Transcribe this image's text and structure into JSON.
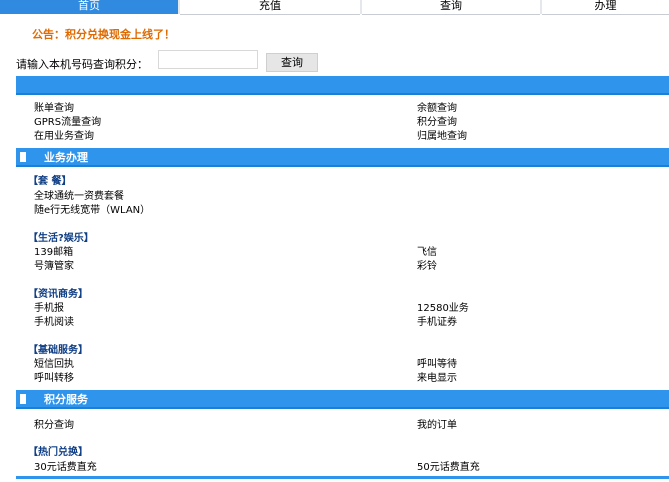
{
  "nav": {
    "tabs": [
      {
        "label": "首页",
        "active": true
      },
      {
        "label": "充值"
      },
      {
        "label": "查询"
      },
      {
        "label": "办理"
      }
    ]
  },
  "notice": "公告：积分兑换现金上线了！",
  "query": {
    "label": "请输入本机号码查询积分：",
    "value": "",
    "button": "查询"
  },
  "sections": {
    "query_items": {
      "left": [
        "账单查询",
        "GPRS流量查询",
        "在用业务查询"
      ],
      "right": [
        "余额查询",
        "积分查询",
        "归属地查询"
      ]
    },
    "business": {
      "title": "业务办理",
      "groups": [
        {
          "title": "【套  餐】",
          "left": [
            "全球通统一资费套餐",
            "随e行无线宽带（WLAN）"
          ],
          "right": []
        },
        {
          "title": "【生活?娱乐】",
          "left": [
            "139邮箱",
            "号簿管家"
          ],
          "right": [
            "飞信",
            "彩铃"
          ]
        },
        {
          "title": "【资讯商务】",
          "left": [
            "手机报",
            "手机阅读"
          ],
          "right": [
            "12580业务",
            "手机证券"
          ]
        },
        {
          "title": "【基础服务】",
          "left": [
            "短信回执",
            "呼叫转移"
          ],
          "right": [
            "呼叫等待",
            "来电显示"
          ]
        }
      ]
    },
    "points": {
      "title": "积分服务",
      "left": [
        "积分查询"
      ],
      "right": [
        "我的订单"
      ]
    },
    "hot": {
      "title": "【热门兑换】",
      "left": [
        "30元话费直充"
      ],
      "right": [
        "50元话费直充"
      ]
    }
  },
  "colors": {
    "bar": "#2f94ec",
    "notice": "#e06a00",
    "group_title": "#103f85"
  }
}
